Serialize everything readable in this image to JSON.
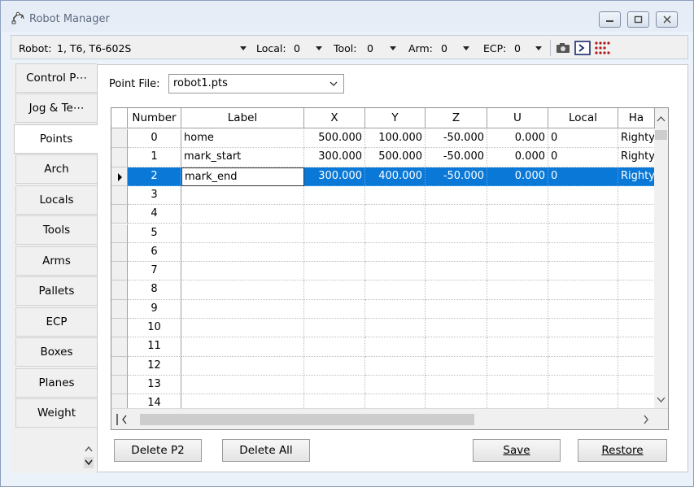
{
  "window": {
    "title": "Robot Manager"
  },
  "toolbar": {
    "robot_label": "Robot:",
    "robot_value": "1, T6, T6-602S",
    "local_label": "Local:",
    "local_value": "0",
    "tool_label": "Tool:",
    "tool_value": "0",
    "arm_label": "Arm:",
    "arm_value": "0",
    "ecp_label": "ECP:",
    "ecp_value": "0",
    "icons": [
      "camera-icon",
      "run-window-icon",
      "io-monitor-icon"
    ]
  },
  "tabs": [
    {
      "label": "Control P⋯",
      "active": false
    },
    {
      "label": "Jog & Te⋯",
      "active": false
    },
    {
      "label": "Points",
      "active": true
    },
    {
      "label": "Arch",
      "active": false
    },
    {
      "label": "Locals",
      "active": false
    },
    {
      "label": "Tools",
      "active": false
    },
    {
      "label": "Arms",
      "active": false
    },
    {
      "label": "Pallets",
      "active": false
    },
    {
      "label": "ECP",
      "active": false
    },
    {
      "label": "Boxes",
      "active": false
    },
    {
      "label": "Planes",
      "active": false
    },
    {
      "label": "Weight",
      "active": false
    }
  ],
  "points": {
    "file_label": "Point File:",
    "file_value": "robot1.pts",
    "columns": [
      "Number",
      "Label",
      "X",
      "Y",
      "Z",
      "U",
      "Local",
      "Ha"
    ],
    "rows": [
      {
        "number": "0",
        "label": "home",
        "x": "500.000",
        "y": "100.000",
        "z": "-50.000",
        "u": "0.000",
        "local": "0",
        "hand": "Righty"
      },
      {
        "number": "1",
        "label": "mark_start",
        "x": "300.000",
        "y": "500.000",
        "z": "-50.000",
        "u": "0.000",
        "local": "0",
        "hand": "Righty"
      },
      {
        "number": "2",
        "label": "mark_end",
        "x": "300.000",
        "y": "400.000",
        "z": "-50.000",
        "u": "0.000",
        "local": "0",
        "hand": "Righty"
      },
      {
        "number": "3"
      },
      {
        "number": "4"
      },
      {
        "number": "5"
      },
      {
        "number": "6"
      },
      {
        "number": "7"
      },
      {
        "number": "8"
      },
      {
        "number": "9"
      },
      {
        "number": "10"
      },
      {
        "number": "11"
      },
      {
        "number": "12"
      },
      {
        "number": "13"
      },
      {
        "number": "14"
      }
    ],
    "selected_row": 2
  },
  "buttons": {
    "delete_point": "Delete P2",
    "delete_all": "Delete All",
    "save": "Save",
    "restore": "Restore"
  },
  "colors": {
    "selection": "#0a78d7",
    "titlebar": "#e6edf6"
  }
}
